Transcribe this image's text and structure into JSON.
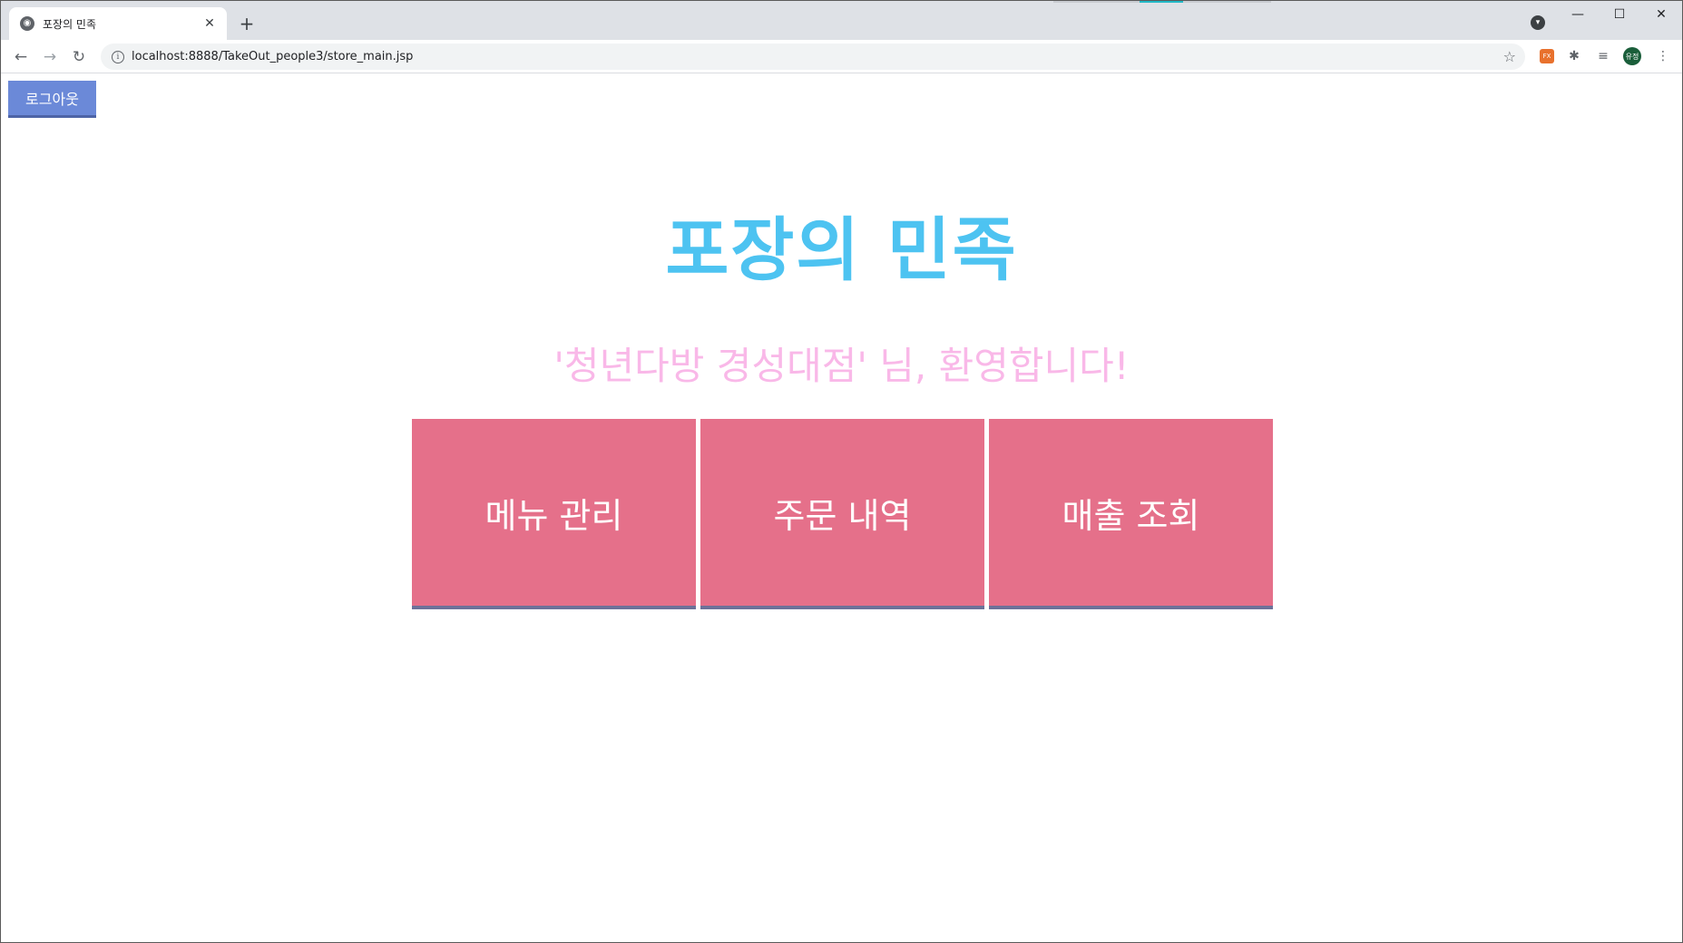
{
  "browser": {
    "tab_title": "포장의 민족",
    "tab_close": "✕",
    "new_tab": "+",
    "url": "localhost:8888/TakeOut_people3/store_main.jsp",
    "window_controls": {
      "minimize": "—",
      "maximize": "☐",
      "close": "✕"
    },
    "extensions": {
      "fx_label": "FX",
      "avatar_label": "유정"
    },
    "icons": [
      "globe-icon",
      "back-icon",
      "forward-icon",
      "reload-icon",
      "info-icon",
      "star-icon",
      "puzzle-icon",
      "reading-list-icon",
      "menu-icon"
    ]
  },
  "page": {
    "logout_label": "로그아웃",
    "brand_title": "포장의 민족",
    "welcome_text": "'청년다방 경성대점' 님, 환영합니다!",
    "menu_buttons": [
      {
        "label": "메뉴 관리"
      },
      {
        "label": "주문 내역"
      },
      {
        "label": "매출 조회"
      }
    ]
  },
  "colors": {
    "brand": "#4dc3f1",
    "welcome": "#f9b8e8",
    "menu_button": "#e5708a",
    "logout_button": "#6b89d8"
  }
}
